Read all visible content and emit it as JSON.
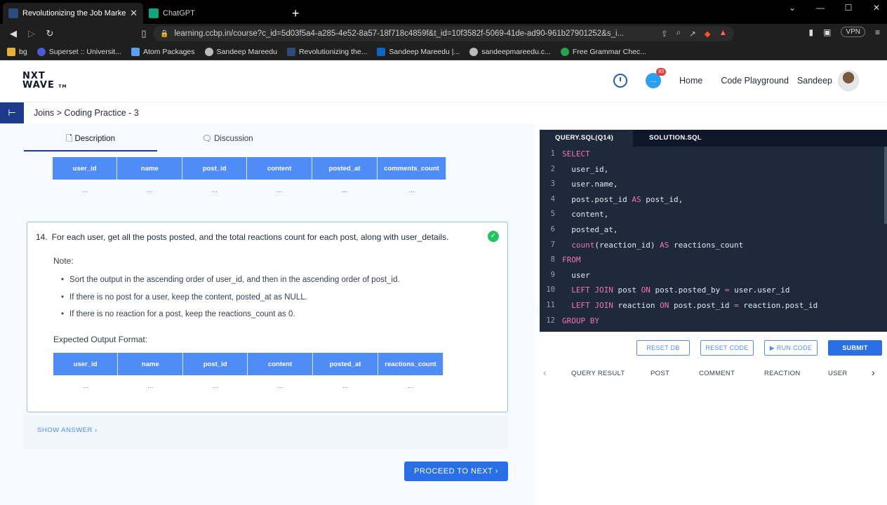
{
  "browser": {
    "tabs": [
      {
        "label": "Revolutionizing the Job Market | N",
        "active": true
      },
      {
        "label": "ChatGPT",
        "active": false
      }
    ],
    "new_tab": "+",
    "url": "learning.ccbp.in/course?c_id=5d03f5a4-a285-4e52-8a57-18f718c4859f&t_id=10f3582f-5069-41de-ad90-961b27901252&s_i...",
    "vpn": "VPN",
    "bookmarks": [
      {
        "label": "bg"
      },
      {
        "label": "Superset :: Universit..."
      },
      {
        "label": "Atom Packages"
      },
      {
        "label": "Sandeep Mareedu"
      },
      {
        "label": "Revolutionizing the..."
      },
      {
        "label": "Sandeep Mareedu |..."
      },
      {
        "label": "sandeepmareedu.c..."
      },
      {
        "label": "Free Grammar Chec..."
      }
    ]
  },
  "header": {
    "logo_line1": "NXT",
    "logo_line2": "WAVE",
    "logo_tm": "TM",
    "notif_count": "83",
    "nav": {
      "home": "Home",
      "playground": "Code Playground",
      "user": "Sandeep"
    }
  },
  "breadcrumb": "Joins > Coding Practice - 3",
  "left_tabs": {
    "description": "Description",
    "discussion": "Discussion"
  },
  "prev_table": {
    "headers": [
      "user_id",
      "name",
      "post_id",
      "content",
      "posted_at",
      "comments_count"
    ],
    "row": [
      "...",
      "...",
      "...",
      "...",
      "...",
      "..."
    ]
  },
  "question": {
    "number": "14.",
    "text": "For each user, get all the posts posted, and the total reactions count for each post, along with user_details.",
    "note_label": "Note:",
    "bullets": [
      "Sort the output in the ascending order of user_id, and then in the ascending order of post_id.",
      "If there is no post for a user, keep the content, posted_at as NULL.",
      "If there is no reaction for a post, keep the reactions_count as 0."
    ],
    "expected_label": "Expected Output Format:",
    "table": {
      "headers": [
        "user_id",
        "name",
        "post_id",
        "content",
        "posted_at",
        "reactions_count"
      ],
      "row": [
        "...",
        "...",
        "...",
        "...",
        "...",
        "..."
      ]
    }
  },
  "show_answer": "SHOW ANSWER ›",
  "proceed": "PROCEED TO NEXT ›",
  "editor": {
    "tabs": {
      "query": "QUERY.SQL(Q14)",
      "solution": "SOLUTION.SQL"
    },
    "lines": [
      {
        "n": "1",
        "parts": [
          {
            "t": "SELECT",
            "c": "kw"
          }
        ]
      },
      {
        "n": "2",
        "parts": [
          {
            "t": "  user_id,",
            "c": ""
          }
        ]
      },
      {
        "n": "3",
        "parts": [
          {
            "t": "  user.name,",
            "c": ""
          }
        ]
      },
      {
        "n": "4",
        "parts": [
          {
            "t": "  post.post_id ",
            "c": ""
          },
          {
            "t": "AS",
            "c": "kw"
          },
          {
            "t": " post_id,",
            "c": ""
          }
        ]
      },
      {
        "n": "5",
        "parts": [
          {
            "t": "  content,",
            "c": ""
          }
        ]
      },
      {
        "n": "6",
        "parts": [
          {
            "t": "  posted_at,",
            "c": ""
          }
        ]
      },
      {
        "n": "7",
        "parts": [
          {
            "t": "  ",
            "c": ""
          },
          {
            "t": "count",
            "c": "fn"
          },
          {
            "t": "(reaction_id) ",
            "c": ""
          },
          {
            "t": "AS",
            "c": "kw"
          },
          {
            "t": " reactions_count",
            "c": ""
          }
        ]
      },
      {
        "n": "8",
        "parts": [
          {
            "t": "FROM",
            "c": "kw"
          }
        ]
      },
      {
        "n": "9",
        "parts": [
          {
            "t": "  user",
            "c": ""
          }
        ]
      },
      {
        "n": "10",
        "parts": [
          {
            "t": "  ",
            "c": ""
          },
          {
            "t": "LEFT JOIN",
            "c": "kw"
          },
          {
            "t": " post ",
            "c": ""
          },
          {
            "t": "ON",
            "c": "kw"
          },
          {
            "t": " post.posted_by ",
            "c": ""
          },
          {
            "t": "=",
            "c": "op"
          },
          {
            "t": " user.user_id",
            "c": ""
          }
        ]
      },
      {
        "n": "11",
        "parts": [
          {
            "t": "  ",
            "c": ""
          },
          {
            "t": "LEFT JOIN",
            "c": "kw"
          },
          {
            "t": " reaction ",
            "c": ""
          },
          {
            "t": "ON",
            "c": "kw"
          },
          {
            "t": " post.post_id ",
            "c": ""
          },
          {
            "t": "=",
            "c": "op"
          },
          {
            "t": " reaction.post_id",
            "c": ""
          }
        ]
      },
      {
        "n": "12",
        "parts": [
          {
            "t": "GROUP BY",
            "c": "kw"
          }
        ]
      }
    ],
    "buttons": {
      "reset_db": "RESET DB",
      "reset_code": "RESET CODE",
      "run_code": "▶ RUN CODE",
      "submit": "SUBMIT"
    },
    "result_tabs": [
      "QUERY RESULT",
      "POST",
      "COMMENT",
      "REACTION",
      "USER"
    ]
  },
  "colors": {
    "accent": "#2b6fe6",
    "table_header": "#4f8cf7",
    "editor_bg": "#1e293b",
    "keyword": "#f472b6"
  }
}
